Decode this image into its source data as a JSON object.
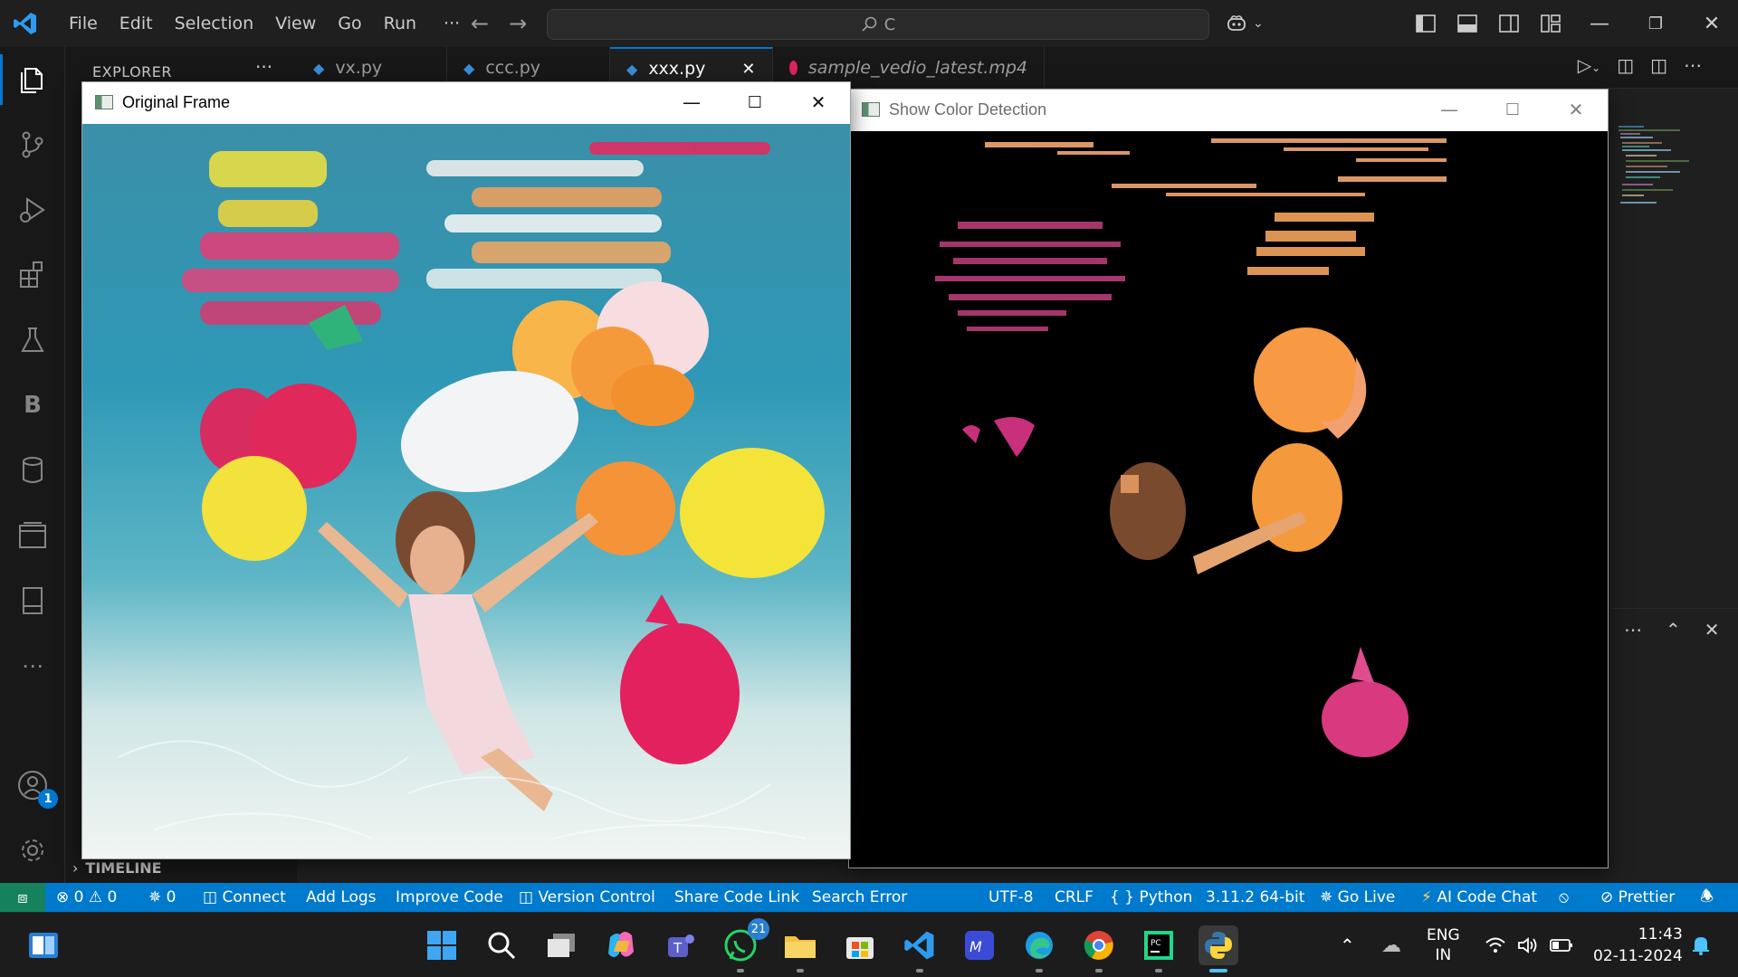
{
  "menu": [
    "File",
    "Edit",
    "Selection",
    "View",
    "Go",
    "Run",
    "···"
  ],
  "command_center": {
    "text": "C"
  },
  "sidebar": {
    "header": "EXPLORER",
    "more": "···",
    "timeline": "TIMELINE"
  },
  "tabs": [
    {
      "label": "vx.py",
      "type": "python"
    },
    {
      "label": "ccc.py",
      "type": "python"
    },
    {
      "label": "xxx.py",
      "type": "python",
      "active": true
    },
    {
      "label": "sample_vedio_latest.mp4",
      "type": "video"
    }
  ],
  "windows": {
    "original": {
      "title": "Original Frame"
    },
    "detection": {
      "title": "Show Color Detection"
    }
  },
  "activity": {
    "accounts_badge": "1",
    "b_label": "B"
  },
  "statusbar": {
    "errors": "0",
    "warnings": "0",
    "ports": "0",
    "connect": "Connect",
    "add_logs": "Add Logs",
    "improve_code": "Improve Code",
    "version_control": "Version Control",
    "share_code_link": "Share Code Link",
    "search_error": "Search Error",
    "encoding": "UTF-8",
    "eol": "CRLF",
    "language": "Python",
    "interpreter": "3.11.2 64-bit",
    "go_live": "Go Live",
    "ai_code_chat": "AI Code Chat",
    "prettier": "Prettier"
  },
  "taskbar": {
    "whatsapp_badge": "21",
    "lang_primary": "ENG",
    "lang_secondary": "IN",
    "time": "11:43",
    "date": "02-11-2024"
  },
  "colors": {
    "accent": "#0078d4",
    "statusbar": "#007acc",
    "remote": "#16825d"
  }
}
